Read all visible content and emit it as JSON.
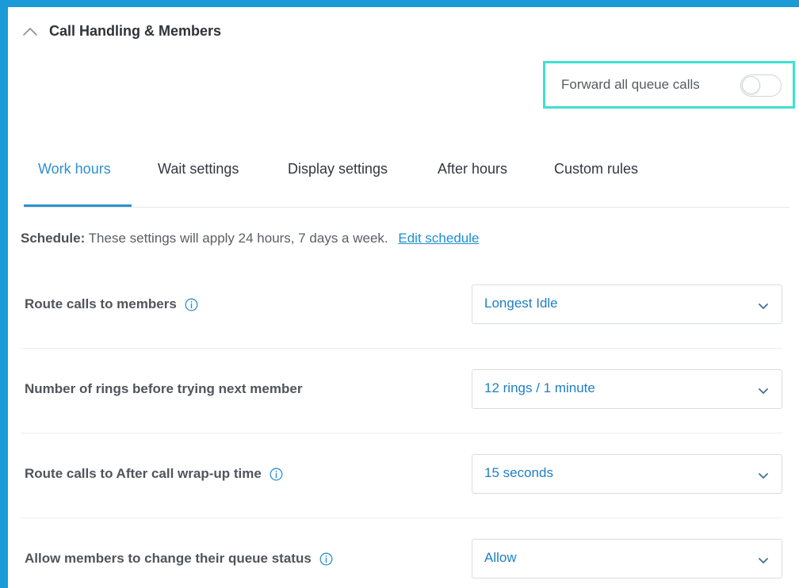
{
  "section": {
    "title": "Call Handling & Members"
  },
  "forward": {
    "label": "Forward all queue calls",
    "enabled": false
  },
  "tabs": [
    {
      "label": "Work hours",
      "active": true
    },
    {
      "label": "Wait settings",
      "active": false
    },
    {
      "label": "Display settings",
      "active": false
    },
    {
      "label": "After hours",
      "active": false
    },
    {
      "label": "Custom rules",
      "active": false
    }
  ],
  "schedule": {
    "label": "Schedule:",
    "text": "These settings will apply 24 hours, 7 days a week.",
    "link": "Edit schedule"
  },
  "settings": [
    {
      "label": "Route calls to members",
      "value": "Longest Idle",
      "has_info": true
    },
    {
      "label": "Number of rings before trying next member",
      "value": "12 rings / 1 minute",
      "has_info": false
    },
    {
      "label": "Route calls to After call wrap-up time",
      "value": "15 seconds",
      "has_info": true
    },
    {
      "label": "Allow members to change their queue status",
      "value": "Allow",
      "has_info": true
    }
  ],
  "colors": {
    "accent": "#2f8fd1",
    "link": "#1a8fd2",
    "highlight_border": "#40e0d0",
    "outer_background": "#1a9ad6"
  },
  "icons": {
    "collapse": "chevron-up-icon",
    "dropdown": "chevron-down-icon",
    "info": "info-icon"
  }
}
